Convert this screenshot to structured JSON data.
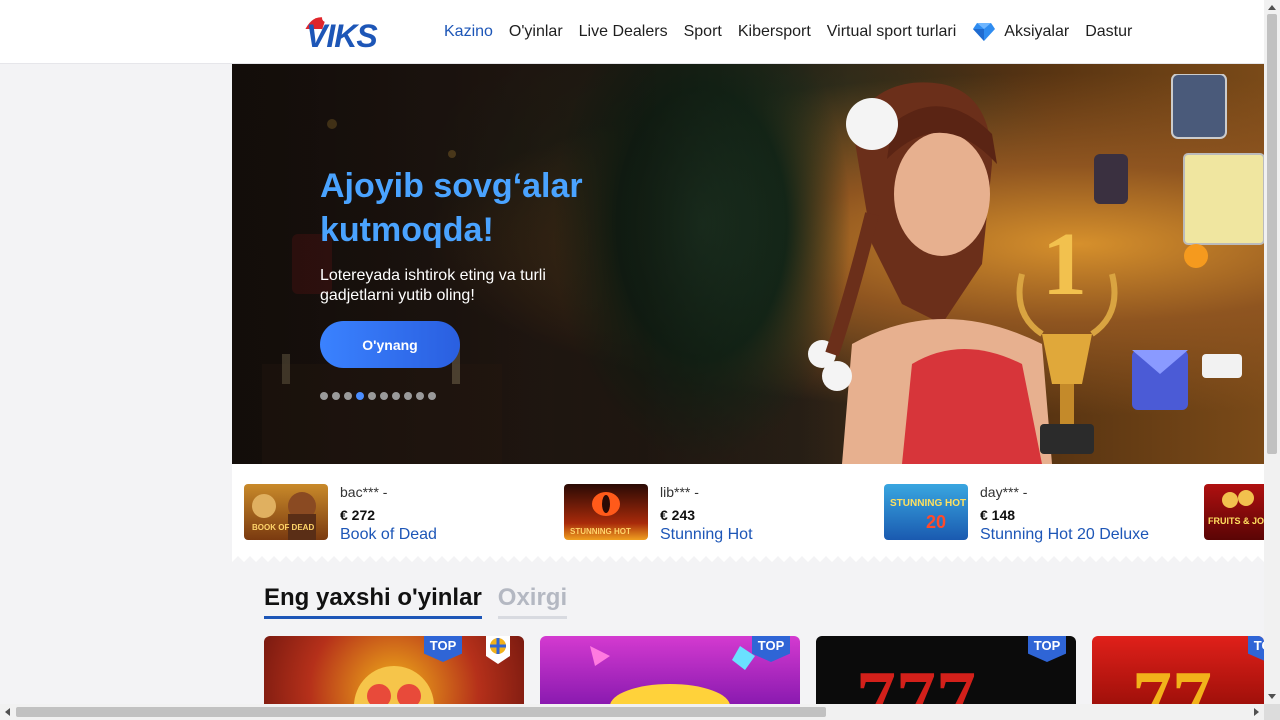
{
  "header": {
    "logo": "VIKS",
    "nav": [
      {
        "label": "Kazino",
        "active": true
      },
      {
        "label": "O'yinlar",
        "active": false
      },
      {
        "label": "Live Dealers",
        "active": false
      },
      {
        "label": "Sport",
        "active": false
      },
      {
        "label": "Kibersport",
        "active": false
      },
      {
        "label": "Virtual sport turlari",
        "active": false
      },
      {
        "label": "Aksiyalar",
        "active": false,
        "icon": "diamond-icon"
      },
      {
        "label": "Dastur",
        "active": false
      }
    ]
  },
  "hero": {
    "title": "Ajoyib sovg‘alar kutmoqda!",
    "subtitle": "Lotereyada ishtirok eting va turli gadjetlarni yutib oling!",
    "button": "O'ynang",
    "slides_count": 10,
    "active_slide": 4
  },
  "winners": [
    {
      "user": "bac*** -",
      "amount": "€ 272",
      "game": "Book of Dead",
      "thumb_text": "BOOK OF DEAD"
    },
    {
      "user": "lib*** -",
      "amount": "€ 243",
      "game": "Stunning Hot",
      "thumb_text": "STUNNING HOT"
    },
    {
      "user": "day*** -",
      "amount": "€ 148",
      "game": "Stunning Hot 20 Deluxe",
      "thumb_text": "STUNNING HOT 20 deluxe"
    },
    {
      "user": "",
      "amount": "",
      "game": "",
      "thumb_text": "FRUITS & JOKERS"
    }
  ],
  "tabs": {
    "best": "Eng yaxshi o'yinlar",
    "latest": "Oxirgi"
  },
  "cards": [
    {
      "badge": "TOP"
    },
    {
      "badge": "TOP"
    },
    {
      "badge": "TOP"
    },
    {
      "badge": "TOP"
    }
  ],
  "colors": {
    "brand": "#1d56b7",
    "accent": "#3a82ff",
    "hero_title": "#4aa3ff"
  }
}
